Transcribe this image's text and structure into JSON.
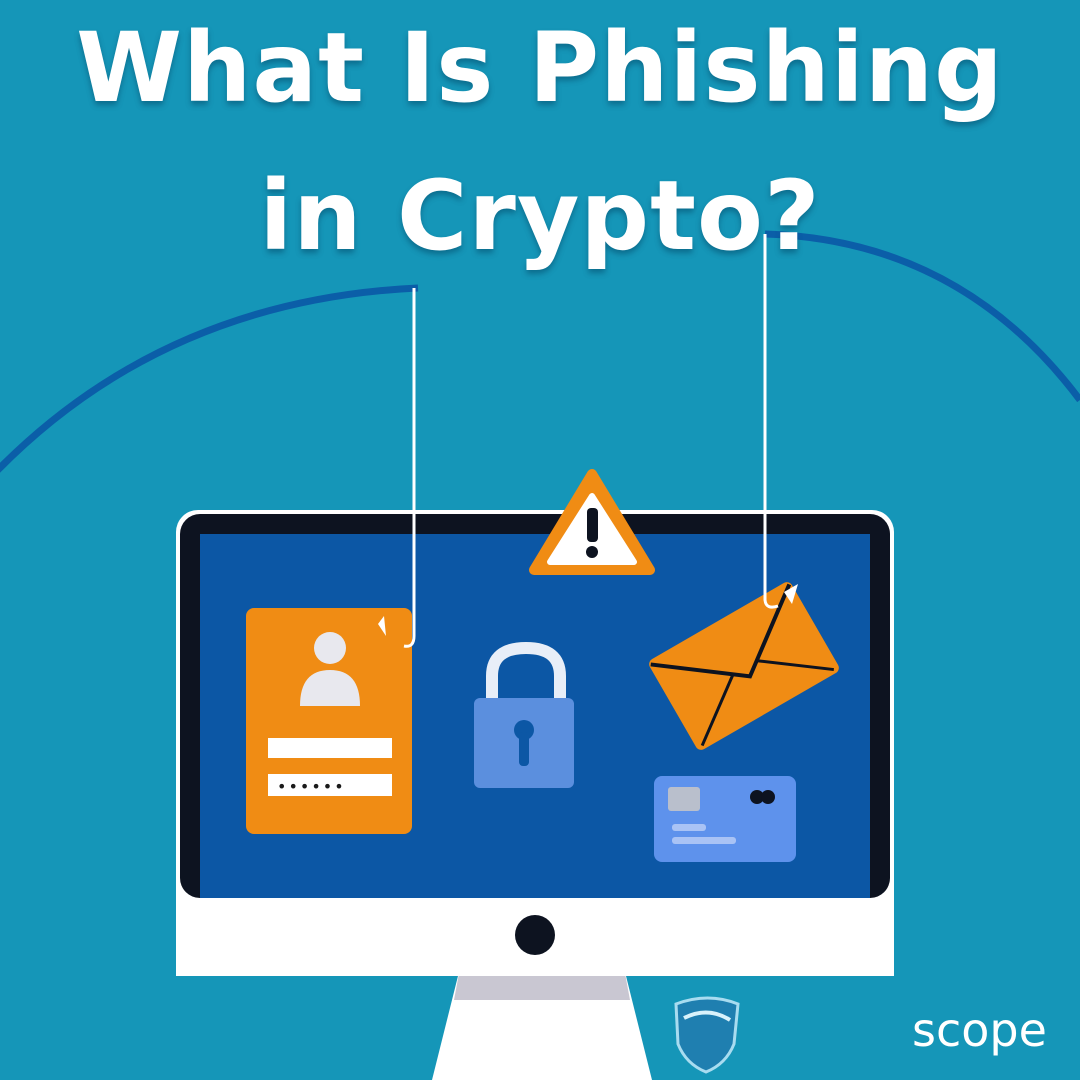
{
  "title": {
    "line1": "What Is Phishing",
    "line2": "in Crypto?"
  },
  "brand": {
    "name": "scope"
  },
  "login_card": {
    "password_mask": "••••••"
  },
  "icons": [
    "warning-icon",
    "user-icon",
    "padlock-icon",
    "envelope-icon",
    "credit-card-icon",
    "fishing-hook-icon",
    "shield-logo-icon"
  ],
  "colors": {
    "background": "#1596b8",
    "arc": "#0b5ea8",
    "screen": "#0c57a5",
    "orange": "#f08c14",
    "lock_blue": "#5b8fde",
    "card_blue": "#5e92ec",
    "white": "#ffffff"
  }
}
